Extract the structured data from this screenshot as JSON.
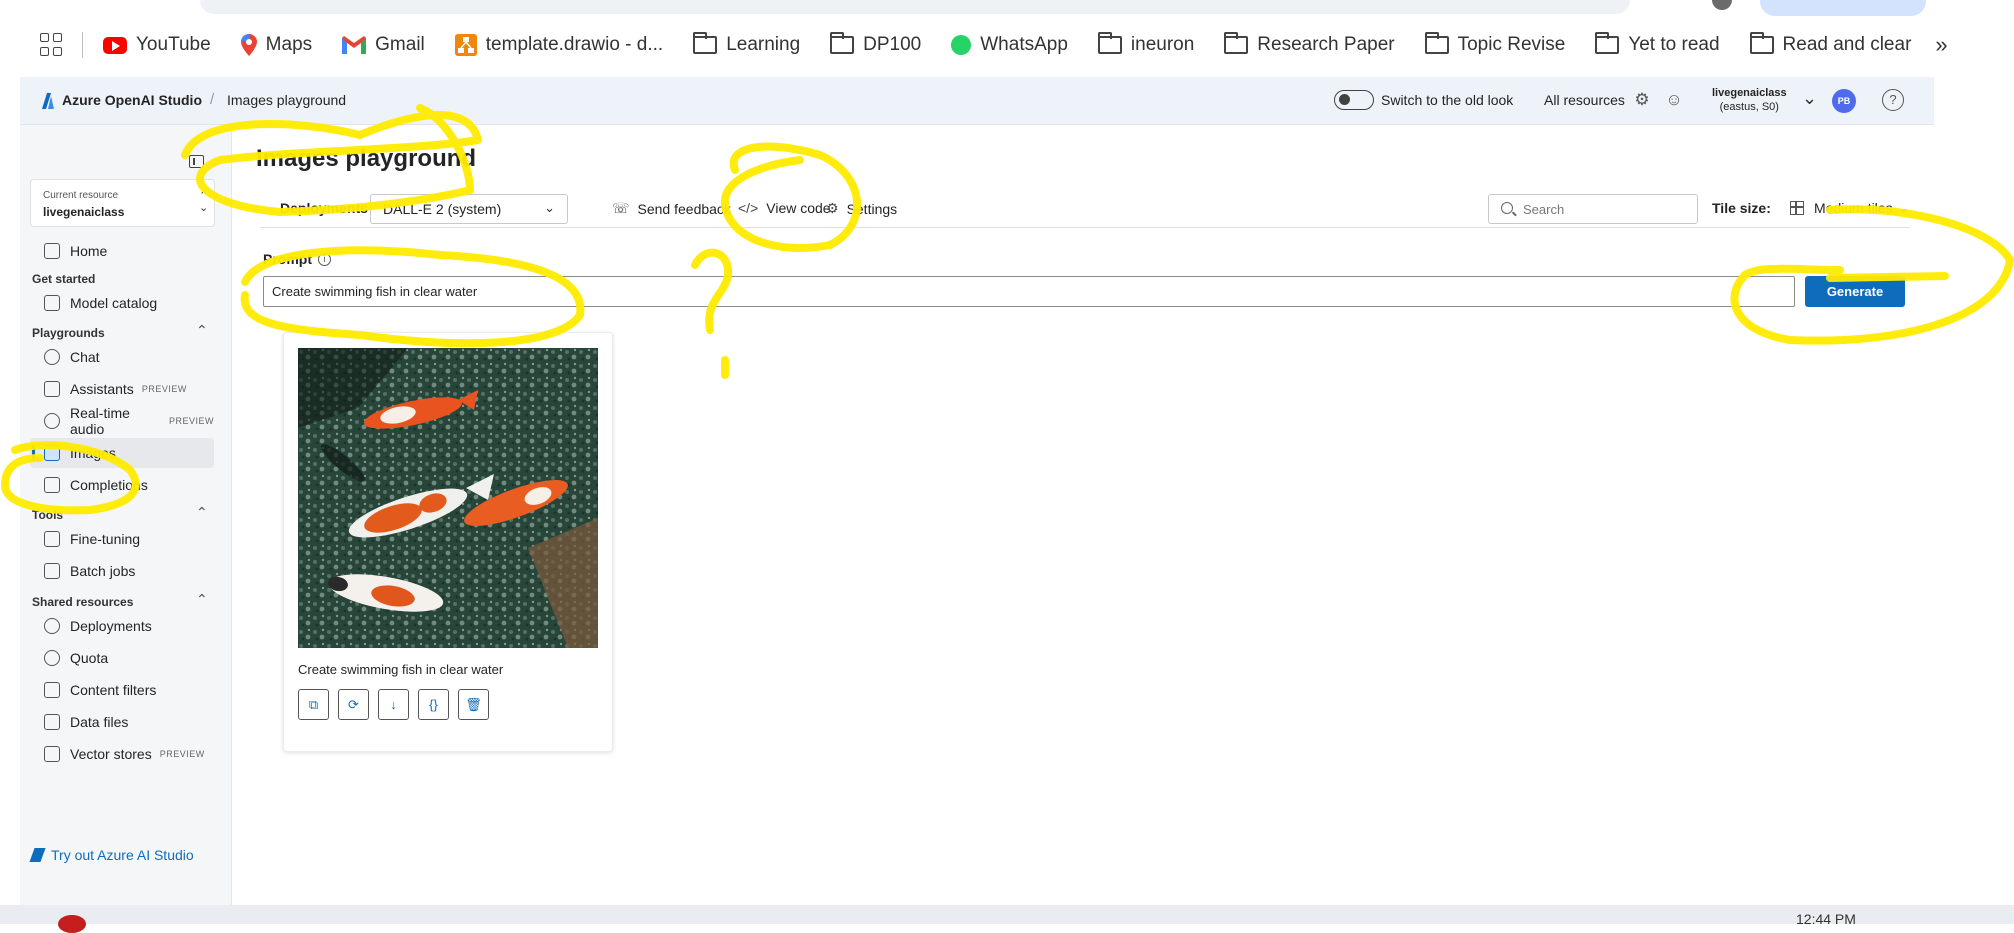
{
  "browser": {
    "bookmarks": [
      {
        "label": "YouTube",
        "icon": "youtube-icon"
      },
      {
        "label": "Maps",
        "icon": "maps-icon"
      },
      {
        "label": "Gmail",
        "icon": "gmail-icon"
      },
      {
        "label": "template.drawio - d...",
        "icon": "drawio-icon"
      },
      {
        "label": "Learning",
        "icon": "folder-icon"
      },
      {
        "label": "DP100",
        "icon": "folder-icon"
      },
      {
        "label": "WhatsApp",
        "icon": "whatsapp-icon"
      },
      {
        "label": "ineuron",
        "icon": "folder-icon"
      },
      {
        "label": "Research Paper",
        "icon": "folder-icon"
      },
      {
        "label": "Topic Revise",
        "icon": "folder-icon"
      },
      {
        "label": "Yet to read",
        "icon": "folder-icon"
      },
      {
        "label": "Read and clear",
        "icon": "folder-icon"
      }
    ],
    "more": "»"
  },
  "topnav": {
    "brand": "Azure OpenAI Studio",
    "separator": "/",
    "breadcrumb": "Images playground",
    "toggle_label": "Switch to the old look",
    "all_resources": "All resources",
    "account_name": "livegenaiclass",
    "account_region": "(eastus, S0)",
    "avatar_initials": "PB"
  },
  "sidebar": {
    "resource_caption": "Current resource",
    "resource_name": "livegenaiclass",
    "home": "Home",
    "get_started": "Get started",
    "model_catalog": "Model catalog",
    "playgrounds": "Playgrounds",
    "chat": "Chat",
    "assistants": "Assistants",
    "assistants_badge": "PREVIEW",
    "realtime": "Real-time audio",
    "realtime_badge": "PREVIEW",
    "images": "Images",
    "completions": "Completions",
    "tools": "Tools",
    "fine_tuning": "Fine-tuning",
    "batch_jobs": "Batch jobs",
    "shared_resources": "Shared resources",
    "deployments": "Deployments",
    "quota": "Quota",
    "content_filters": "Content filters",
    "data_files": "Data files",
    "vector_stores": "Vector stores",
    "vector_badge": "PREVIEW",
    "try_azure": "Try out Azure AI Studio"
  },
  "main": {
    "title": "Images playground",
    "deployments_label": "Deployments",
    "deployment_value": "DALL-E 2 (system)",
    "send_feedback": "Send feedback",
    "view_code": "View code",
    "settings": "Settings",
    "search_placeholder": "Search",
    "tile_size_label": "Tile size:",
    "tile_size_value": "Medium tiles",
    "prompt_label": "Prompt",
    "prompt_value": "Create swimming fish in clear water",
    "generate": "Generate",
    "card_caption": "Create swimming fish in clear water"
  },
  "taskbar": {
    "clock": "12:44 PM"
  },
  "colors": {
    "accent": "#0f6cbd",
    "annotation": "#ffeb00"
  }
}
